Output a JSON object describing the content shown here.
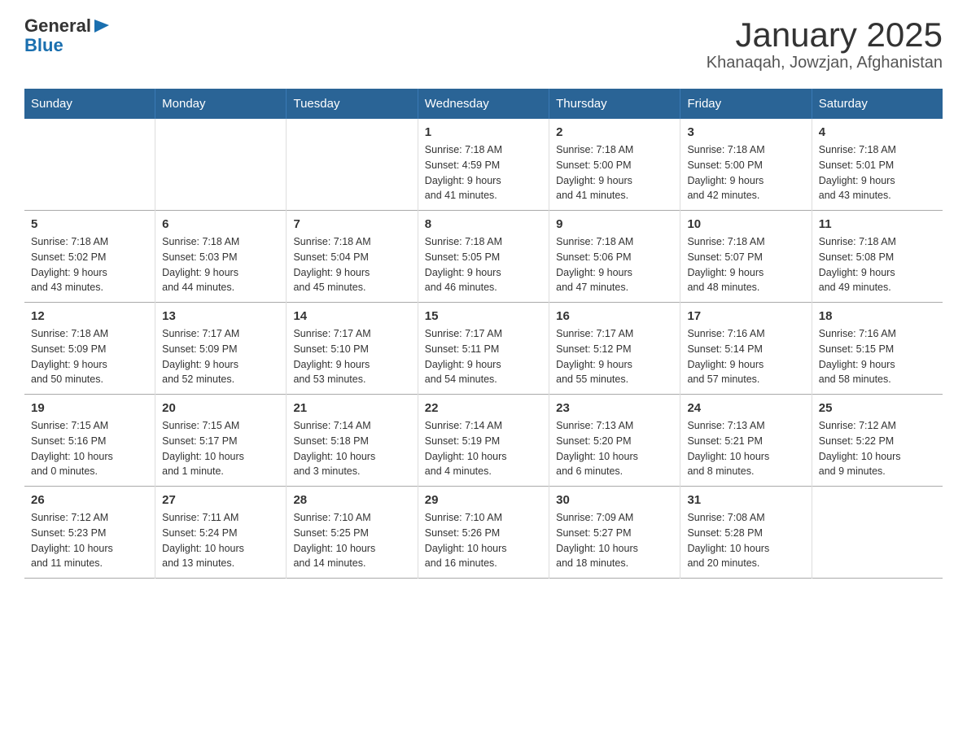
{
  "logo": {
    "text_general": "General",
    "triangle": "▶",
    "text_blue": "Blue"
  },
  "title": "January 2025",
  "subtitle": "Khanaqah, Jowzjan, Afghanistan",
  "days_of_week": [
    "Sunday",
    "Monday",
    "Tuesday",
    "Wednesday",
    "Thursday",
    "Friday",
    "Saturday"
  ],
  "weeks": [
    [
      {
        "day": "",
        "info": ""
      },
      {
        "day": "",
        "info": ""
      },
      {
        "day": "",
        "info": ""
      },
      {
        "day": "1",
        "info": "Sunrise: 7:18 AM\nSunset: 4:59 PM\nDaylight: 9 hours\nand 41 minutes."
      },
      {
        "day": "2",
        "info": "Sunrise: 7:18 AM\nSunset: 5:00 PM\nDaylight: 9 hours\nand 41 minutes."
      },
      {
        "day": "3",
        "info": "Sunrise: 7:18 AM\nSunset: 5:00 PM\nDaylight: 9 hours\nand 42 minutes."
      },
      {
        "day": "4",
        "info": "Sunrise: 7:18 AM\nSunset: 5:01 PM\nDaylight: 9 hours\nand 43 minutes."
      }
    ],
    [
      {
        "day": "5",
        "info": "Sunrise: 7:18 AM\nSunset: 5:02 PM\nDaylight: 9 hours\nand 43 minutes."
      },
      {
        "day": "6",
        "info": "Sunrise: 7:18 AM\nSunset: 5:03 PM\nDaylight: 9 hours\nand 44 minutes."
      },
      {
        "day": "7",
        "info": "Sunrise: 7:18 AM\nSunset: 5:04 PM\nDaylight: 9 hours\nand 45 minutes."
      },
      {
        "day": "8",
        "info": "Sunrise: 7:18 AM\nSunset: 5:05 PM\nDaylight: 9 hours\nand 46 minutes."
      },
      {
        "day": "9",
        "info": "Sunrise: 7:18 AM\nSunset: 5:06 PM\nDaylight: 9 hours\nand 47 minutes."
      },
      {
        "day": "10",
        "info": "Sunrise: 7:18 AM\nSunset: 5:07 PM\nDaylight: 9 hours\nand 48 minutes."
      },
      {
        "day": "11",
        "info": "Sunrise: 7:18 AM\nSunset: 5:08 PM\nDaylight: 9 hours\nand 49 minutes."
      }
    ],
    [
      {
        "day": "12",
        "info": "Sunrise: 7:18 AM\nSunset: 5:09 PM\nDaylight: 9 hours\nand 50 minutes."
      },
      {
        "day": "13",
        "info": "Sunrise: 7:17 AM\nSunset: 5:09 PM\nDaylight: 9 hours\nand 52 minutes."
      },
      {
        "day": "14",
        "info": "Sunrise: 7:17 AM\nSunset: 5:10 PM\nDaylight: 9 hours\nand 53 minutes."
      },
      {
        "day": "15",
        "info": "Sunrise: 7:17 AM\nSunset: 5:11 PM\nDaylight: 9 hours\nand 54 minutes."
      },
      {
        "day": "16",
        "info": "Sunrise: 7:17 AM\nSunset: 5:12 PM\nDaylight: 9 hours\nand 55 minutes."
      },
      {
        "day": "17",
        "info": "Sunrise: 7:16 AM\nSunset: 5:14 PM\nDaylight: 9 hours\nand 57 minutes."
      },
      {
        "day": "18",
        "info": "Sunrise: 7:16 AM\nSunset: 5:15 PM\nDaylight: 9 hours\nand 58 minutes."
      }
    ],
    [
      {
        "day": "19",
        "info": "Sunrise: 7:15 AM\nSunset: 5:16 PM\nDaylight: 10 hours\nand 0 minutes."
      },
      {
        "day": "20",
        "info": "Sunrise: 7:15 AM\nSunset: 5:17 PM\nDaylight: 10 hours\nand 1 minute."
      },
      {
        "day": "21",
        "info": "Sunrise: 7:14 AM\nSunset: 5:18 PM\nDaylight: 10 hours\nand 3 minutes."
      },
      {
        "day": "22",
        "info": "Sunrise: 7:14 AM\nSunset: 5:19 PM\nDaylight: 10 hours\nand 4 minutes."
      },
      {
        "day": "23",
        "info": "Sunrise: 7:13 AM\nSunset: 5:20 PM\nDaylight: 10 hours\nand 6 minutes."
      },
      {
        "day": "24",
        "info": "Sunrise: 7:13 AM\nSunset: 5:21 PM\nDaylight: 10 hours\nand 8 minutes."
      },
      {
        "day": "25",
        "info": "Sunrise: 7:12 AM\nSunset: 5:22 PM\nDaylight: 10 hours\nand 9 minutes."
      }
    ],
    [
      {
        "day": "26",
        "info": "Sunrise: 7:12 AM\nSunset: 5:23 PM\nDaylight: 10 hours\nand 11 minutes."
      },
      {
        "day": "27",
        "info": "Sunrise: 7:11 AM\nSunset: 5:24 PM\nDaylight: 10 hours\nand 13 minutes."
      },
      {
        "day": "28",
        "info": "Sunrise: 7:10 AM\nSunset: 5:25 PM\nDaylight: 10 hours\nand 14 minutes."
      },
      {
        "day": "29",
        "info": "Sunrise: 7:10 AM\nSunset: 5:26 PM\nDaylight: 10 hours\nand 16 minutes."
      },
      {
        "day": "30",
        "info": "Sunrise: 7:09 AM\nSunset: 5:27 PM\nDaylight: 10 hours\nand 18 minutes."
      },
      {
        "day": "31",
        "info": "Sunrise: 7:08 AM\nSunset: 5:28 PM\nDaylight: 10 hours\nand 20 minutes."
      },
      {
        "day": "",
        "info": ""
      }
    ]
  ]
}
